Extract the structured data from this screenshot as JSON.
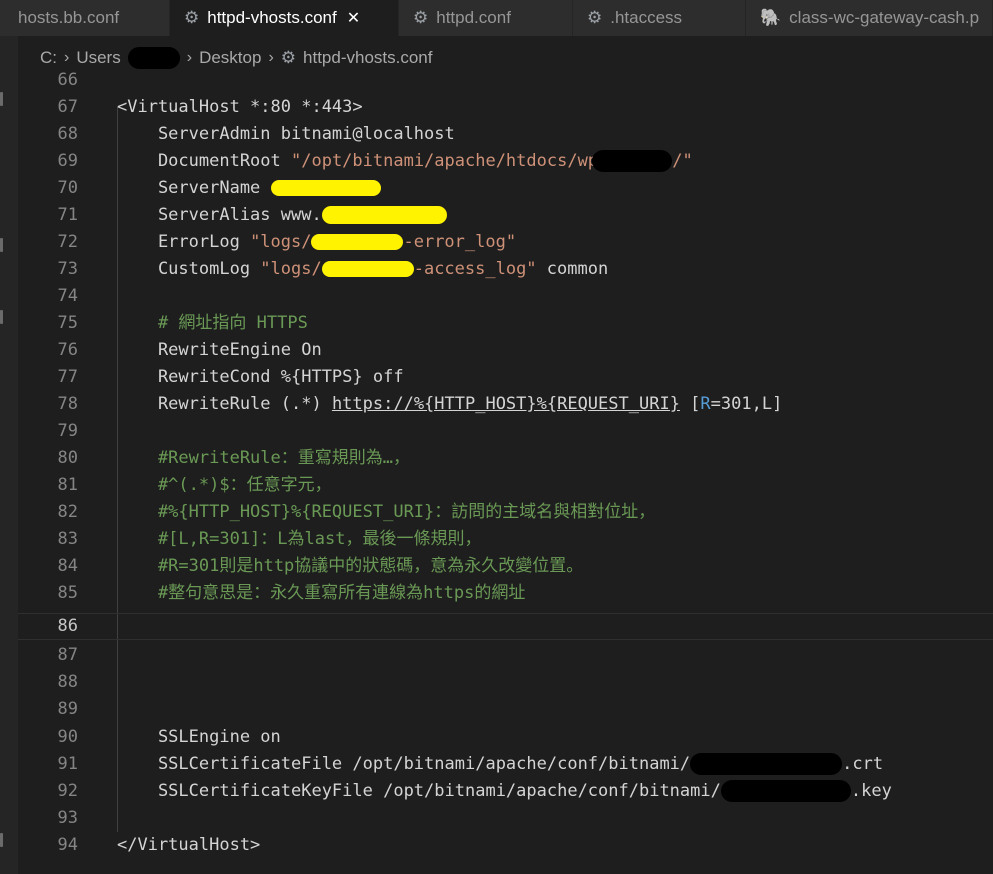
{
  "tabs": [
    {
      "label": "hosts.bb.conf",
      "icon": "none",
      "active": false
    },
    {
      "label": "httpd-vhosts.conf",
      "icon": "gear-icon",
      "active": true
    },
    {
      "label": "httpd.conf",
      "icon": "gear-icon",
      "active": false
    },
    {
      "label": ".htaccess",
      "icon": "gear-icon",
      "active": false
    },
    {
      "label": "class-wc-gateway-cash.p",
      "icon": "php-elephant-icon",
      "active": false
    }
  ],
  "breadcrumb": {
    "drive": "C:",
    "users": "Users",
    "desktop": "Desktop",
    "file": "httpd-vhosts.conf"
  },
  "editor": {
    "l66": "66",
    "l67": "67",
    "c67": "<VirtualHost *:80 *:443>",
    "l68": "68",
    "c68": "    ServerAdmin bitnami@localhost",
    "l69": "69",
    "c69a": "    DocumentRoot ",
    "c69b": "\"/opt/bitnami/apache/htdocs/wp_",
    "c69c": "/\"",
    "l70": "70",
    "c70": "    ServerName ",
    "l71": "71",
    "c71": "    ServerAlias www.",
    "l72": "72",
    "c72a": "    ErrorLog ",
    "c72b": "\"logs/",
    "c72c": "-error_log\"",
    "l73": "73",
    "c73a": "    CustomLog ",
    "c73b": "\"logs/",
    "c73c": "-access_log\"",
    "c73d": " common",
    "l74": "74",
    "l75": "75",
    "c75": "    # 網址指向 HTTPS",
    "l76": "76",
    "c76": "    RewriteEngine On",
    "l77": "77",
    "c77": "    RewriteCond %{HTTPS} off",
    "l78": "78",
    "c78a": "    RewriteRule (.*) ",
    "c78b": "https://%{HTTP_HOST}%{REQUEST_URI}",
    "c78c": " [",
    "c78d": "R",
    "c78e": "=301,L]",
    "l79": "79",
    "l80": "80",
    "c80": "    #RewriteRule：重寫規則為…，",
    "l81": "81",
    "c81": "    #^(.*)$：任意字元，",
    "l82": "82",
    "c82": "    #%{HTTP_HOST}%{REQUEST_URI}：訪問的主域名與相對位址，",
    "l83": "83",
    "c83": "    #[L,R=301]：L為last，最後一條規則，",
    "l84": "84",
    "c84": "    #R=301則是http協議中的狀態碼，意為永久改變位置。",
    "l85": "85",
    "c85": "    #整句意思是：永久重寫所有連線為https的網址",
    "l86": "86",
    "l87": "87",
    "l88": "88",
    "l89": "89",
    "l90": "90",
    "c90": "    SSLEngine on",
    "l91": "91",
    "c91a": "    SSLCertificateFile /opt/bitnami/apache/conf/bitnami/",
    "c91b": ".crt",
    "l92": "92",
    "c92a": "    SSLCertificateKeyFile /opt/bitnami/apache/conf/bitnami/",
    "c92b": ".key",
    "l93": "93",
    "l94": "94",
    "c94": "</VirtualHost>"
  }
}
